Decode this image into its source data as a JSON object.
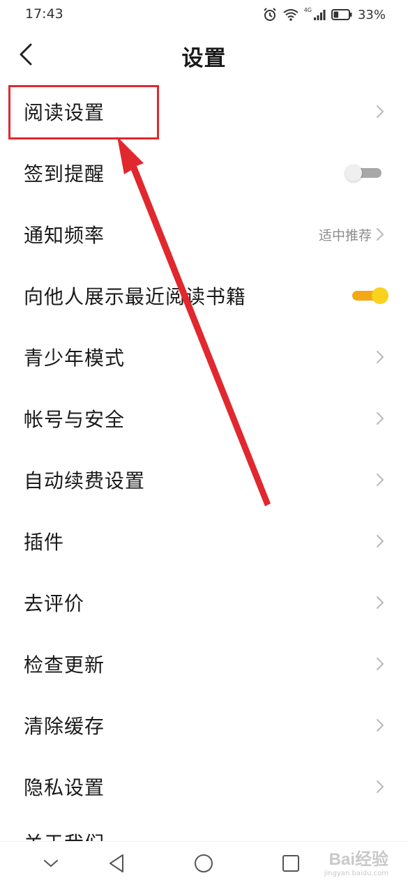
{
  "status_bar": {
    "time": "17:43",
    "network_label": "4G",
    "battery_percent": "33%",
    "battery_level": 0.33,
    "icons": [
      "alarm-icon",
      "wifi-icon",
      "signal-icon",
      "battery-icon"
    ]
  },
  "header": {
    "title": "设置",
    "back_icon": "chevron-left-icon"
  },
  "settings": [
    {
      "label": "阅读设置",
      "control": "chevron"
    },
    {
      "label": "签到提醒",
      "control": "toggle",
      "enabled": false
    },
    {
      "label": "通知频率",
      "control": "chevron",
      "value": "适中推荐"
    },
    {
      "label": "向他人展示最近阅读书籍",
      "control": "toggle",
      "enabled": true
    },
    {
      "label": "青少年模式",
      "control": "chevron"
    },
    {
      "label": "帐号与安全",
      "control": "chevron"
    },
    {
      "label": "自动续费设置",
      "control": "chevron"
    },
    {
      "label": "插件",
      "control": "chevron"
    },
    {
      "label": "去评价",
      "control": "chevron"
    },
    {
      "label": "检查更新",
      "control": "chevron"
    },
    {
      "label": "清除缓存",
      "control": "chevron"
    },
    {
      "label": "隐私设置",
      "control": "chevron"
    },
    {
      "label": "关于我们",
      "control": "chevron",
      "partially_visible": true
    }
  ],
  "annotation": {
    "type": "highlight-box-with-arrow",
    "color": "#e0282e",
    "target": "阅读设置"
  },
  "nav_bar": {
    "buttons": [
      "chevron-down-icon",
      "back-triangle-icon",
      "home-circle-icon",
      "recents-square-icon"
    ]
  },
  "watermark": {
    "text": "Bai经验",
    "subtext": "jingyan.baidu.com"
  },
  "colors": {
    "toggle_on_track": "#f4a814",
    "toggle_on_knob": "#f8d21c",
    "toggle_off_track": "#a8a8a8",
    "annotation_red": "#e0282e"
  }
}
